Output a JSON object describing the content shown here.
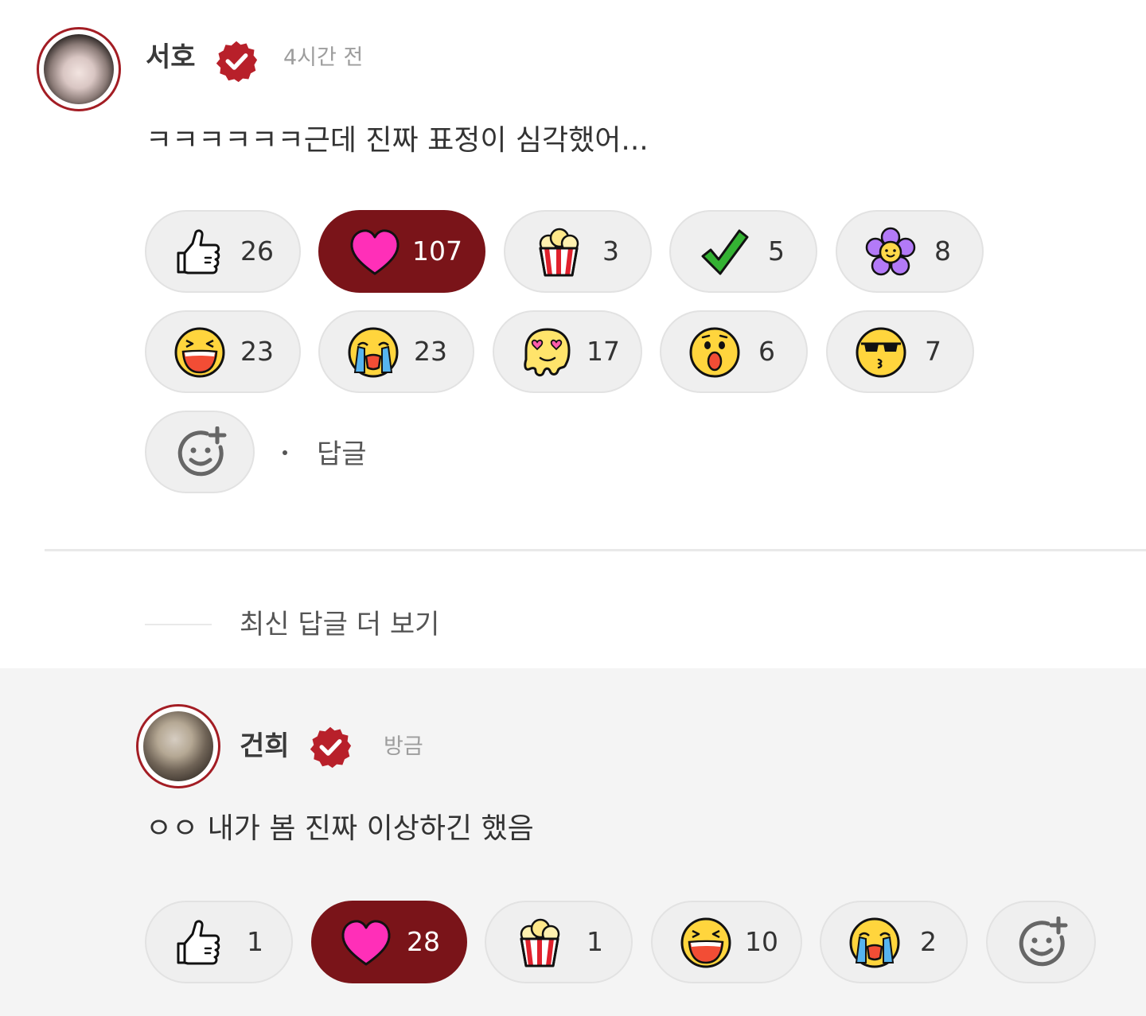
{
  "comment": {
    "author": "서호",
    "time": "4시간 전",
    "text": "ㅋㅋㅋㅋㅋㅋ근데 진짜 표정이 심각했어...",
    "reactions": [
      {
        "icon": "thumbs-up",
        "count": "26"
      },
      {
        "icon": "heart",
        "count": "107",
        "selected": true
      },
      {
        "icon": "popcorn",
        "count": "3"
      },
      {
        "icon": "check",
        "count": "5"
      },
      {
        "icon": "flower",
        "count": "8"
      },
      {
        "icon": "laughing-face",
        "count": "23"
      },
      {
        "icon": "crying-face",
        "count": "23"
      },
      {
        "icon": "melting-love-face",
        "count": "17"
      },
      {
        "icon": "surprised-face",
        "count": "6"
      },
      {
        "icon": "sunglasses-face",
        "count": "7"
      }
    ],
    "reply_label": "답글"
  },
  "more_replies_label": "최신 답글 더 보기",
  "reply": {
    "author": "건희",
    "time": "방금",
    "text": "ㅇㅇ 내가 봄 진짜 이상하긴 했음",
    "reactions": [
      {
        "icon": "thumbs-up",
        "count": "1"
      },
      {
        "icon": "heart",
        "count": "28",
        "selected": true
      },
      {
        "icon": "popcorn",
        "count": "1"
      },
      {
        "icon": "laughing-face",
        "count": "10"
      },
      {
        "icon": "crying-face",
        "count": "2"
      }
    ]
  },
  "colors": {
    "accent": "#a31d24",
    "selected_pill": "#7a1419",
    "heart": "#ff2fb8",
    "pill_bg": "#efefef",
    "section_bg": "#f4f4f4"
  }
}
